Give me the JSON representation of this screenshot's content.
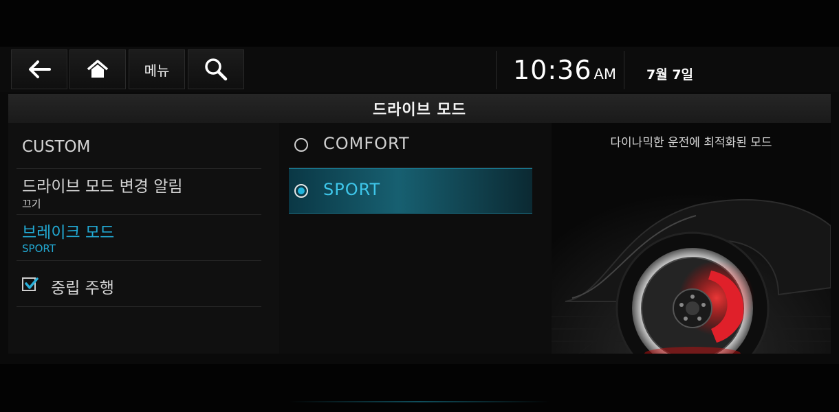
{
  "topbar": {
    "menu_label": "메뉴",
    "time": "10:36",
    "ampm": "AM",
    "date": "7월 7일",
    "icons": [
      "back-arrow-icon",
      "home-icon",
      "search-icon"
    ]
  },
  "header": {
    "title": "드라이브 모드"
  },
  "settings": {
    "custom_label": "CUSTOM",
    "drive_mode_alert": {
      "title": "드라이브 모드 변경 알림",
      "value": "끄기"
    },
    "brake_mode": {
      "title": "브레이크 모드",
      "value": "SPORT"
    },
    "neutral_driving": {
      "label": "중립 주행",
      "checked": true
    }
  },
  "options": [
    {
      "label": "COMFORT",
      "selected": false
    },
    {
      "label": "SPORT",
      "selected": true
    }
  ],
  "preview": {
    "description": "다이나믹한 운전에 최적화된 모드"
  },
  "colors": {
    "accent": "#22a9d3",
    "background": "#0a0a0a",
    "brake_caliper": "#e0202a"
  }
}
